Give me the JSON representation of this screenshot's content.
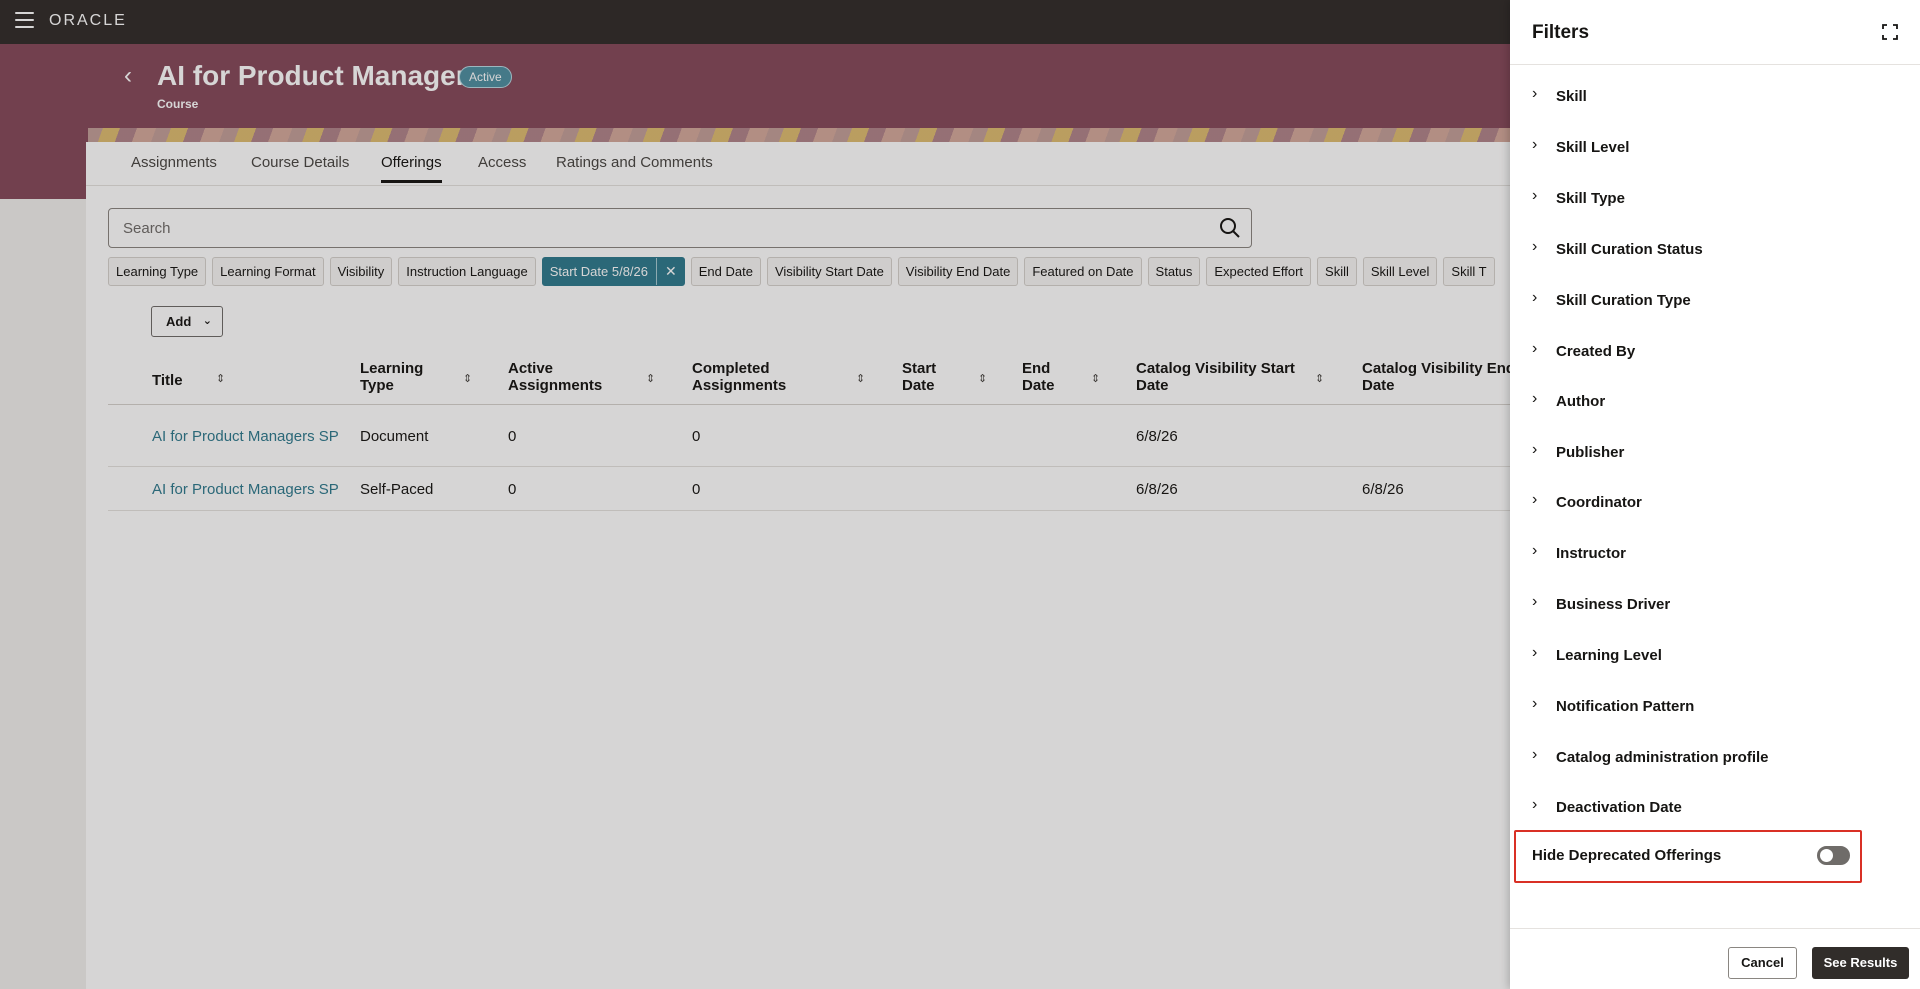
{
  "app": {
    "brand": "ORACLE"
  },
  "header": {
    "title": "AI for Product Managers",
    "status": "Active",
    "subtitle": "Course"
  },
  "tabs": [
    {
      "label": "Assignments"
    },
    {
      "label": "Course Details"
    },
    {
      "label": "Offerings",
      "active": true
    },
    {
      "label": "Access"
    },
    {
      "label": "Ratings and Comments"
    }
  ],
  "search": {
    "placeholder": "Search"
  },
  "filter_chips": [
    {
      "label": "Learning Type"
    },
    {
      "label": "Learning Format"
    },
    {
      "label": "Visibility"
    },
    {
      "label": "Instruction Language"
    },
    {
      "label": "Start Date 5/8/26",
      "selected": true
    },
    {
      "label": "End Date"
    },
    {
      "label": "Visibility Start Date"
    },
    {
      "label": "Visibility End Date"
    },
    {
      "label": "Featured on Date"
    },
    {
      "label": "Status"
    },
    {
      "label": "Expected Effort"
    },
    {
      "label": "Skill"
    },
    {
      "label": "Skill Level"
    },
    {
      "label": "Skill T"
    }
  ],
  "toolbar": {
    "add_label": "Add"
  },
  "table": {
    "columns": [
      {
        "line1": "Title",
        "line2": ""
      },
      {
        "line1": "Learning",
        "line2": "Type"
      },
      {
        "line1": "Active",
        "line2": "Assignments"
      },
      {
        "line1": "Completed",
        "line2": "Assignments"
      },
      {
        "line1": "Start",
        "line2": "Date"
      },
      {
        "line1": "End",
        "line2": "Date"
      },
      {
        "line1": "Catalog Visibility Start",
        "line2": "Date"
      },
      {
        "line1": "Catalog Visibility End",
        "line2": "Date"
      }
    ],
    "rows": [
      {
        "title": "AI for Product Managers SP",
        "learning_type": "Document",
        "active": "0",
        "completed": "0",
        "start": "",
        "end": "",
        "cat_start": "6/8/26",
        "cat_end": ""
      },
      {
        "title": "AI for Product Managers SP",
        "learning_type": "Self-Paced",
        "active": "0",
        "completed": "0",
        "start": "",
        "end": "",
        "cat_start": "6/8/26",
        "cat_end": "6/8/26"
      }
    ]
  },
  "drawer": {
    "title": "Filters",
    "items": [
      {
        "label": "Skill"
      },
      {
        "label": "Skill Level"
      },
      {
        "label": "Skill Type"
      },
      {
        "label": "Skill Curation Status"
      },
      {
        "label": "Skill Curation Type"
      },
      {
        "label": "Created By"
      },
      {
        "label": "Author"
      },
      {
        "label": "Publisher"
      },
      {
        "label": "Coordinator"
      },
      {
        "label": "Instructor"
      },
      {
        "label": "Business Driver"
      },
      {
        "label": "Learning Level"
      },
      {
        "label": "Notification Pattern"
      },
      {
        "label": "Catalog administration profile"
      },
      {
        "label": "Deactivation Date"
      }
    ],
    "hide_deprecated": {
      "label": "Hide Deprecated Offerings",
      "value": false
    },
    "cancel_label": "Cancel",
    "see_results_label": "See Results"
  },
  "colors": {
    "topbar": "#312d2a",
    "banner": "#864a5b",
    "accent": "#2f7a8e",
    "highlight_border": "#d93025"
  }
}
